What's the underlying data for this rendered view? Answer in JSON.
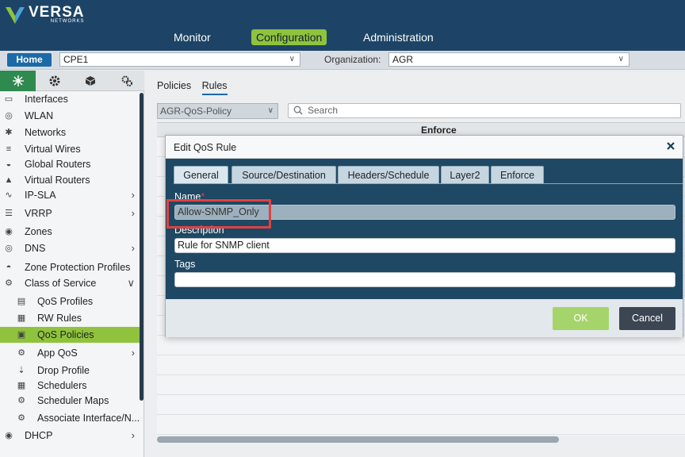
{
  "brand": {
    "name": "VERSA",
    "sub": "NETWORKS"
  },
  "nav": {
    "items": [
      {
        "label": "Monitor"
      },
      {
        "label": "Configuration"
      },
      {
        "label": "Administration"
      }
    ]
  },
  "context": {
    "home": "Home",
    "device": "CPE1",
    "org_label": "Organization:",
    "org": "AGR"
  },
  "sidebar": {
    "tab_icons": [
      "network-icon",
      "gear-icon",
      "cube-icon",
      "gears-icon"
    ],
    "items": [
      {
        "label": "Interfaces",
        "icon": "interfaces-icon",
        "sub": false,
        "arrow": ""
      },
      {
        "label": "WLAN",
        "icon": "wlan-icon",
        "sub": false,
        "arrow": ""
      },
      {
        "label": "Networks",
        "icon": "networks-icon",
        "sub": false,
        "arrow": ""
      },
      {
        "label": "Virtual Wires",
        "icon": "virtual-wires-icon",
        "sub": false,
        "arrow": ""
      },
      {
        "label": "Global Routers",
        "icon": "global-routers-icon",
        "sub": false,
        "arrow": ""
      },
      {
        "label": "Virtual Routers",
        "icon": "virtual-routers-icon",
        "sub": false,
        "arrow": ""
      },
      {
        "label": "IP-SLA",
        "icon": "ip-sla-icon",
        "sub": false,
        "arrow": ">"
      },
      {
        "label": "VRRP",
        "icon": "vrrp-icon",
        "sub": false,
        "arrow": ">"
      },
      {
        "label": "Zones",
        "icon": "zones-icon",
        "sub": false,
        "arrow": ""
      },
      {
        "label": "DNS",
        "icon": "dns-icon",
        "sub": false,
        "arrow": ">"
      },
      {
        "label": "Zone Protection Profiles",
        "icon": "zone-protection-icon",
        "sub": false,
        "arrow": ""
      },
      {
        "label": "Class of Service",
        "icon": "class-of-service-icon",
        "sub": false,
        "arrow": "v"
      },
      {
        "label": "QoS Profiles",
        "icon": "qos-profiles-icon",
        "sub": true,
        "arrow": ""
      },
      {
        "label": "RW Rules",
        "icon": "rw-rules-icon",
        "sub": true,
        "arrow": ""
      },
      {
        "label": "QoS Policies",
        "icon": "qos-policies-icon",
        "sub": true,
        "arrow": "",
        "selected": true
      },
      {
        "label": "App QoS",
        "icon": "app-qos-icon",
        "sub": true,
        "arrow": ">"
      },
      {
        "label": "Drop Profile",
        "icon": "drop-profile-icon",
        "sub": true,
        "arrow": ""
      },
      {
        "label": "Schedulers",
        "icon": "schedulers-icon",
        "sub": true,
        "arrow": ""
      },
      {
        "label": "Scheduler Maps",
        "icon": "scheduler-maps-icon",
        "sub": true,
        "arrow": ""
      },
      {
        "label": "Associate Interface/N...",
        "icon": "associate-interface-icon",
        "sub": true,
        "arrow": ""
      },
      {
        "label": "DHCP",
        "icon": "dhcp-icon",
        "sub": false,
        "arrow": ">"
      }
    ]
  },
  "content": {
    "tabs": [
      "Policies",
      "Rules"
    ],
    "policy": "AGR-QoS-Policy",
    "search_placeholder": "Search",
    "grid_header": "Enforce"
  },
  "modal": {
    "title": "Edit QoS Rule",
    "tabs": [
      "General",
      "Source/Destination",
      "Headers/Schedule",
      "Layer2",
      "Enforce"
    ],
    "fields": {
      "name_label": "Name",
      "name_required": "*",
      "name_value": "Allow-SNMP_Only",
      "description_label": "Description",
      "description_value": "Rule for SNMP client",
      "tags_label": "Tags",
      "tags_value": ""
    },
    "ok": "OK",
    "cancel": "Cancel"
  },
  "colors": {
    "header": "#1d4466",
    "accent": "#8fc33d",
    "modal_body": "#1e4863",
    "highlight": "#e04141"
  }
}
